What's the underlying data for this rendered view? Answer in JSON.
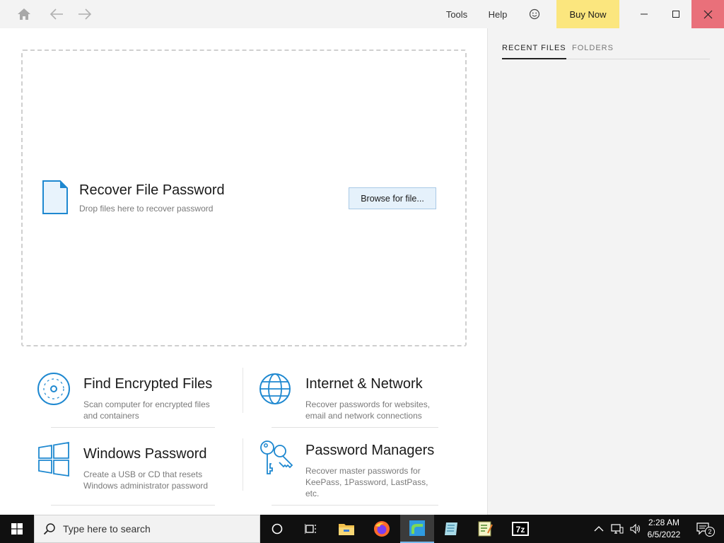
{
  "titlebar": {
    "tools_label": "Tools",
    "help_label": "Help",
    "buy_now_label": "Buy Now"
  },
  "right_panel": {
    "tabs": [
      {
        "label": "RECENT FILES",
        "active": true
      },
      {
        "label": "FOLDERS",
        "active": false
      }
    ]
  },
  "dropzone": {
    "title": "Recover File Password",
    "subtitle": "Drop files here to recover password",
    "browse_label": "Browse for file..."
  },
  "tiles": [
    {
      "title": "Find Encrypted Files",
      "desc": "Scan computer for encrypted files and containers",
      "icon": "disc-icon"
    },
    {
      "title": "Internet & Network",
      "desc": "Recover passwords for websites, email and network connections",
      "icon": "globe-icon"
    },
    {
      "title": "Windows Password",
      "desc": "Create a USB or CD that resets Windows administrator password",
      "icon": "windows-logo-icon"
    },
    {
      "title": "Password Managers",
      "desc": "Recover master passwords for KeePass, 1Password, LastPass, etc.",
      "icon": "keys-icon"
    }
  ],
  "taskbar": {
    "search_placeholder": "Type here to search",
    "time": "2:28 AM",
    "date": "6/5/2022",
    "notification_count": "2",
    "apps": [
      "file-explorer-icon",
      "firefox-icon",
      "passper-app-icon",
      "notepad-app-icon",
      "editor-app-icon",
      "7zip-icon"
    ]
  },
  "colors": {
    "accent": "#1e88d0",
    "buy_now_bg": "#fbe67e",
    "close_bg": "#e9707a"
  }
}
